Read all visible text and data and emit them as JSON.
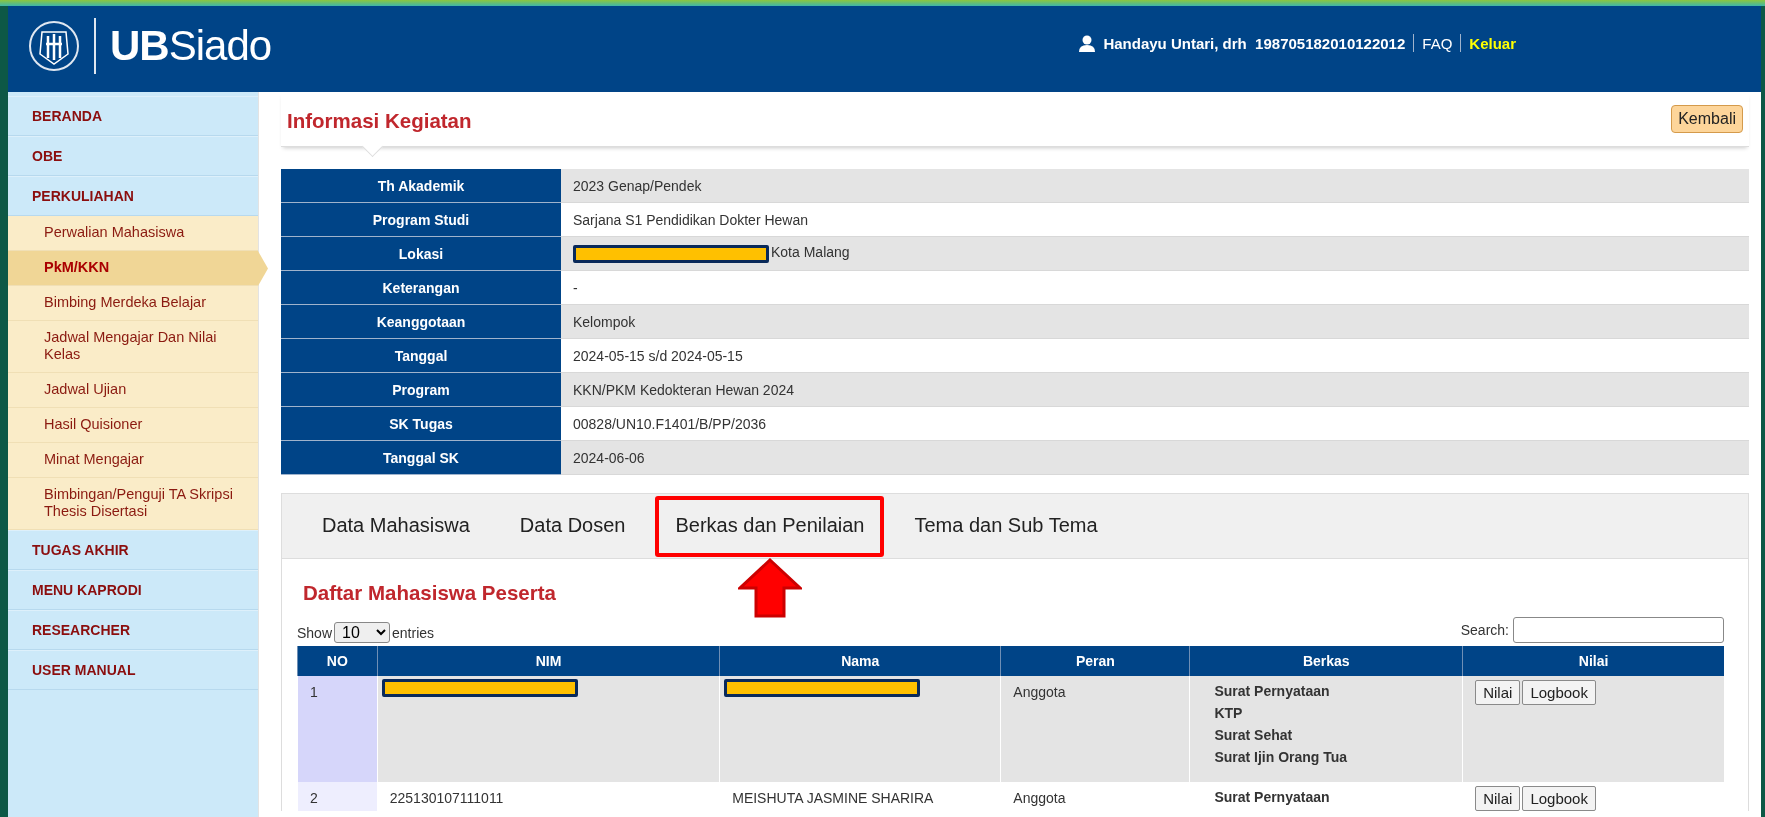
{
  "header": {
    "logo_text": "**UB**Siado",
    "user_name": "Handayu Untari, drh",
    "user_id": "198705182010122012",
    "links": [
      {
        "label": "FAQ",
        "kind": "plain"
      },
      {
        "label": "Keluar",
        "kind": "highlight"
      }
    ]
  },
  "sidebar": {
    "items": [
      {
        "label": "BERANDA",
        "selected": false
      },
      {
        "label": "OBE",
        "selected": false
      },
      {
        "label": "PERKULIAHAN",
        "selected": false,
        "children": [
          {
            "label": "Perwalian Mahasiswa",
            "selected": false
          },
          {
            "label": "PkM/KKN",
            "selected": true
          },
          {
            "label": "Bimbing Merdeka Belajar",
            "selected": false
          },
          {
            "label": "Jadwal Mengajar Dan Nilai Kelas",
            "selected": false
          },
          {
            "label": "Jadwal Ujian",
            "selected": false
          },
          {
            "label": "Hasil Quisioner",
            "selected": false
          },
          {
            "label": "Minat Mengajar",
            "selected": false
          },
          {
            "label": "Bimbingan/Penguji TA Skripsi Thesis Disertasi",
            "selected": false
          }
        ]
      },
      {
        "label": "TUGAS AKHIR",
        "selected": false
      },
      {
        "label": "MENU KAPRODI",
        "selected": false
      },
      {
        "label": "RESEARCHER",
        "selected": false
      },
      {
        "label": "USER MANUAL",
        "selected": false
      }
    ]
  },
  "page": {
    "title": "Informasi Kegiatan",
    "back_button": "Kembali"
  },
  "info": {
    "rows": [
      {
        "label": "Th Akademik",
        "value": "2023 Genap/Pendek",
        "redacted": false
      },
      {
        "label": "Program Studi",
        "value": "Sarjana S1 Pendidikan Dokter Hewan",
        "redacted": false
      },
      {
        "label": "Lokasi",
        "value": "Kota Malang",
        "redacted": true
      },
      {
        "label": "Keterangan",
        "value": "-",
        "redacted": false
      },
      {
        "label": "Keanggotaan",
        "value": "Kelompok",
        "redacted": false
      },
      {
        "label": "Tanggal",
        "value": "2024-05-15 s/d 2024-05-15",
        "redacted": false
      },
      {
        "label": "Program",
        "value": "KKN/PKM Kedokteran Hewan 2024",
        "redacted": false
      },
      {
        "label": "SK Tugas",
        "value": "00828/UN10.F1401/B/PP/2036",
        "redacted": false
      },
      {
        "label": "Tanggal SK",
        "value": "2024-06-06",
        "redacted": false
      }
    ]
  },
  "tabs": [
    {
      "label": "Data Mahasiswa",
      "annotated": false
    },
    {
      "label": "Data Dosen",
      "annotated": false
    },
    {
      "label": "Berkas dan Penilaian",
      "annotated": true
    },
    {
      "label": "Tema dan Sub Tema",
      "annotated": false
    }
  ],
  "section_title": "Daftar Mahasiswa Peserta",
  "table": {
    "show_label": "Show",
    "page_size": "10",
    "entries_label": "entries",
    "search_label": "Search:",
    "columns": [
      "NO",
      "NIM",
      "Nama",
      "Peran",
      "Berkas",
      "Nilai"
    ],
    "rows": [
      {
        "no": "1",
        "nim": {
          "redacted": true
        },
        "nama": {
          "redacted": true
        },
        "peran": "Anggota",
        "berkas": [
          "Surat Pernyataan",
          "KTP",
          "Surat Sehat",
          "Surat Ijin Orang Tua"
        ],
        "actions": [
          "Nilai",
          "Logbook"
        ]
      },
      {
        "no": "2",
        "nim": {
          "text": "225130107111011",
          "redacted": false
        },
        "nama": {
          "text": "MEISHUTA JASMINE SHARIRA",
          "redacted": false
        },
        "peran": "Anggota",
        "berkas": [
          "Surat Pernyataan"
        ],
        "actions": [
          "Nilai",
          "Logbook"
        ]
      }
    ]
  }
}
